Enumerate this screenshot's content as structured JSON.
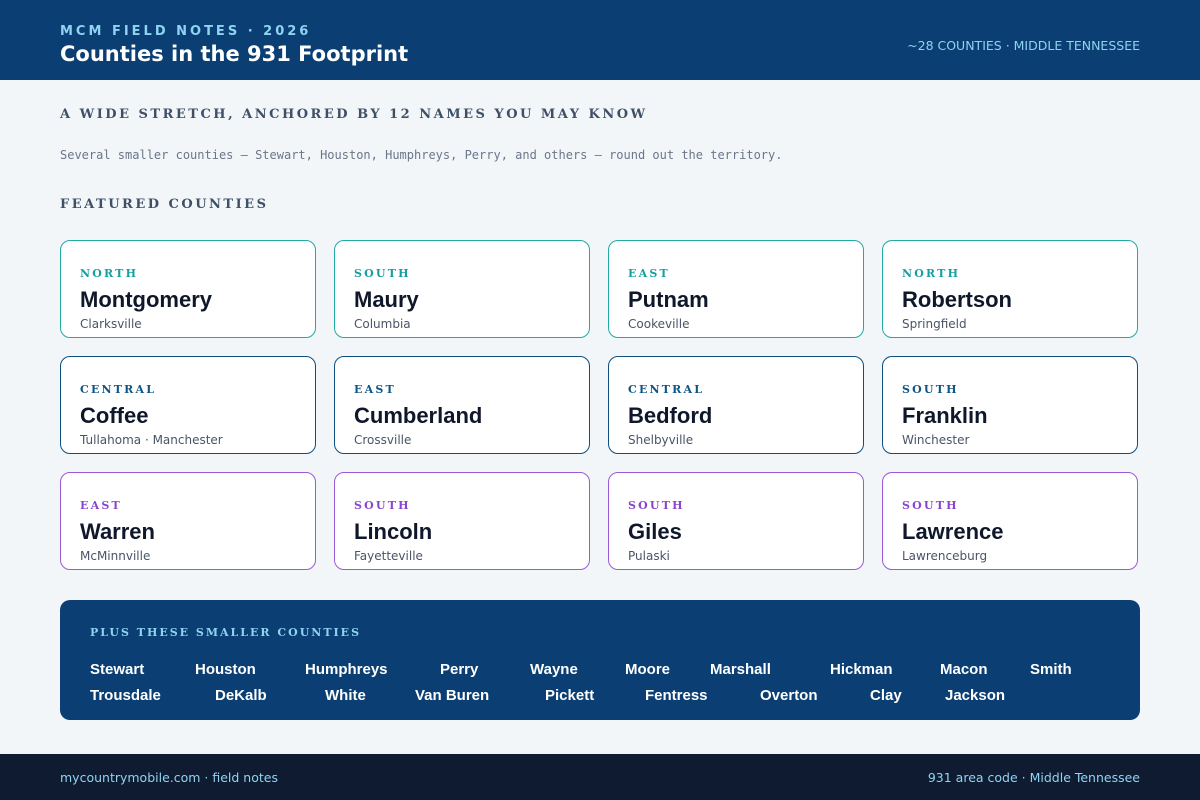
{
  "header": {
    "kicker": "MCM FIELD NOTES · 2026",
    "title": "Counties in the 931 Footprint",
    "right": "~28 COUNTIES · MIDDLE TENNESSEE"
  },
  "intro": {
    "heading": "A WIDE STRETCH, ANCHORED BY 12 NAMES YOU MAY KNOW",
    "subtitle": "Several smaller counties — Stewart, Houston, Humphreys, Perry, and others — round out the territory."
  },
  "featured": {
    "heading": "FEATURED COUNTIES",
    "cards": [
      {
        "region": "NORTH",
        "name": "Montgomery",
        "city": "Clarksville"
      },
      {
        "region": "SOUTH",
        "name": "Maury",
        "city": "Columbia"
      },
      {
        "region": "EAST",
        "name": "Putnam",
        "city": "Cookeville"
      },
      {
        "region": "NORTH",
        "name": "Robertson",
        "city": "Springfield"
      },
      {
        "region": "CENTRAL",
        "name": "Coffee",
        "city": "Tullahoma · Manchester"
      },
      {
        "region": "EAST",
        "name": "Cumberland",
        "city": "Crossville"
      },
      {
        "region": "CENTRAL",
        "name": "Bedford",
        "city": "Shelbyville"
      },
      {
        "region": "SOUTH",
        "name": "Franklin",
        "city": "Winchester"
      },
      {
        "region": "EAST",
        "name": "Warren",
        "city": "McMinnville"
      },
      {
        "region": "SOUTH",
        "name": "Lincoln",
        "city": "Fayetteville"
      },
      {
        "region": "SOUTH",
        "name": "Giles",
        "city": "Pulaski"
      },
      {
        "region": "SOUTH",
        "name": "Lawrence",
        "city": "Lawrenceburg"
      }
    ]
  },
  "smaller": {
    "heading": "PLUS THESE SMALLER COUNTIES",
    "counties": [
      "Stewart",
      "Houston",
      "Humphreys",
      "Perry",
      "Wayne",
      "Moore",
      "Marshall",
      "Hickman",
      "Macon",
      "Smith",
      "Trousdale",
      "DeKalb",
      "White",
      "Van Buren",
      "Pickett",
      "Fentress",
      "Overton",
      "Clay",
      "Jackson"
    ]
  },
  "footer": {
    "left": "mycountrymobile.com · field notes",
    "right": "931 area code · Middle Tennessee"
  }
}
